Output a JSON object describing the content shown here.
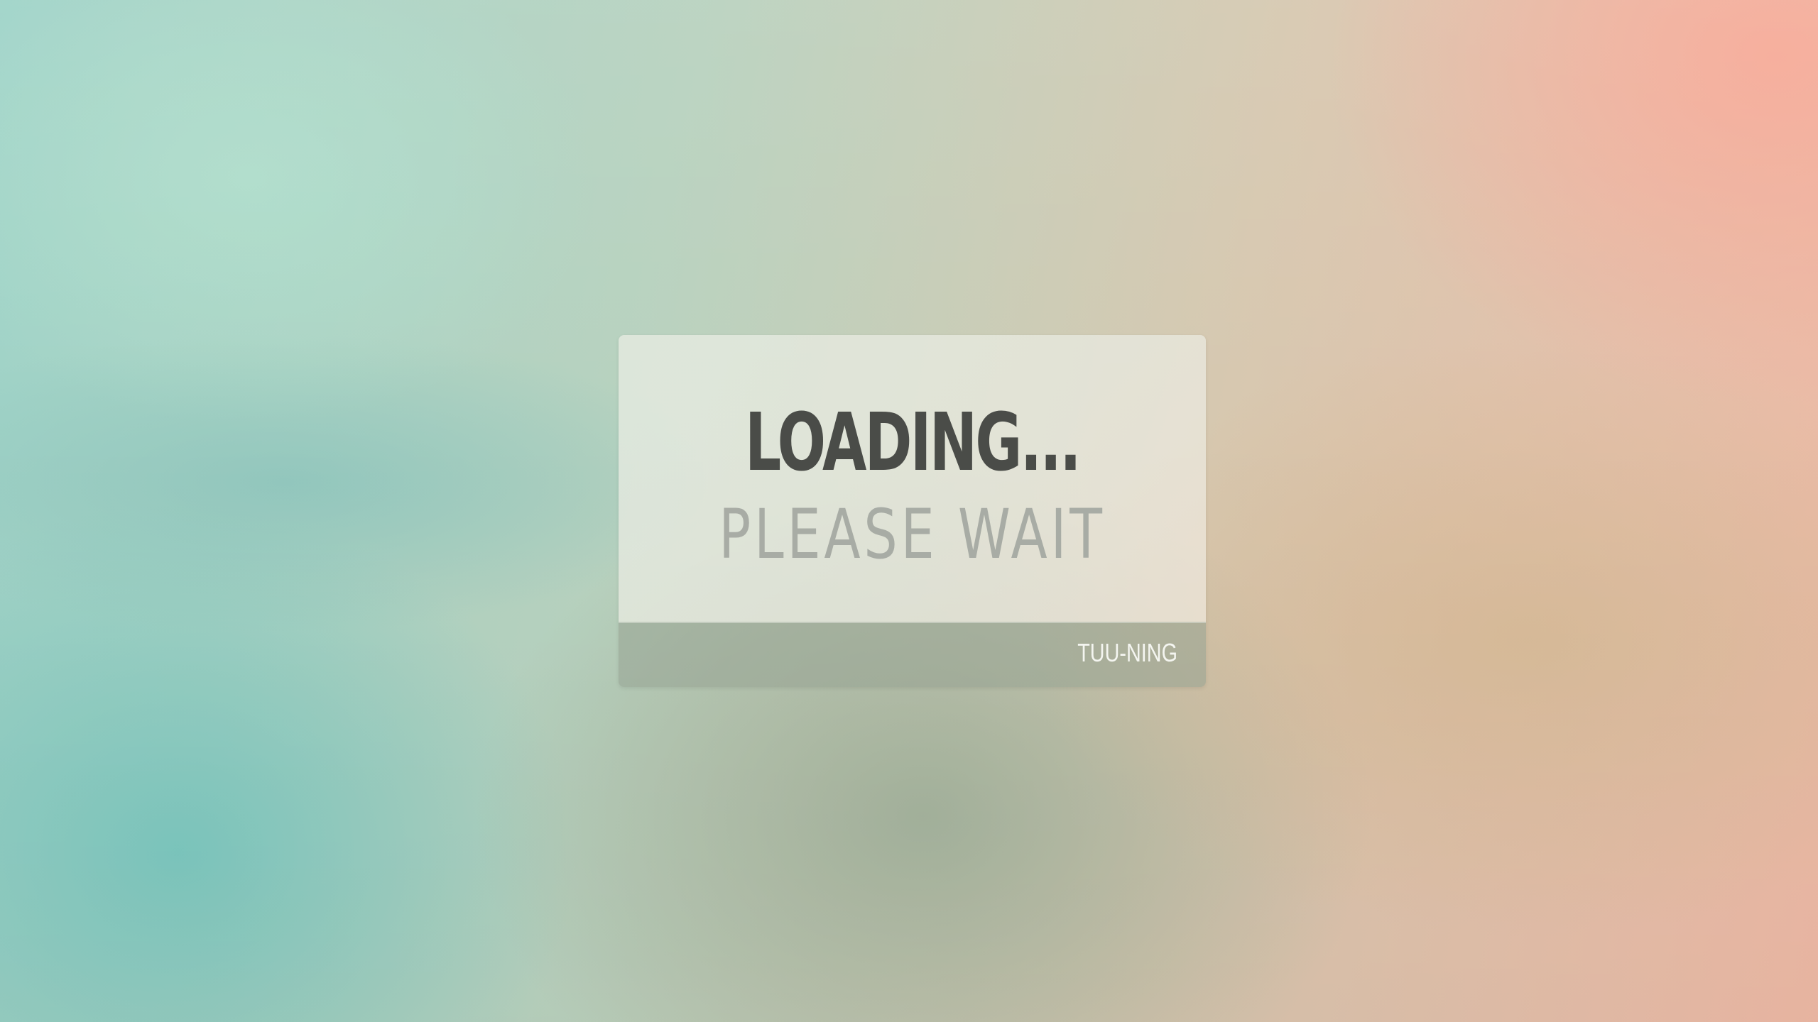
{
  "loader": {
    "title": "LOADING...",
    "subtitle": "PLEASE WAIT",
    "brand": "TUU-NING"
  },
  "colors": {
    "title": "#4a4c48",
    "subtitle": "#a8aca5",
    "brand": "#f4f5f0",
    "background_left": "#9ed3c8",
    "background_right": "#eeb9a5"
  }
}
